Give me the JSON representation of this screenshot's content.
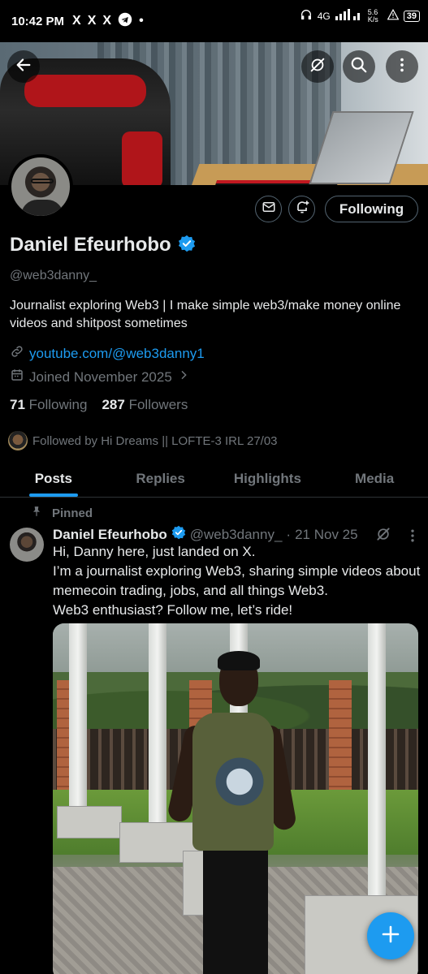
{
  "status_bar": {
    "time": "10:42 PM",
    "app_icons": [
      "X",
      "X",
      "X"
    ],
    "network": "4G",
    "speed": "5.6 K/s",
    "battery": "39"
  },
  "profile": {
    "display_name": "Daniel Efeurhobo",
    "handle": "@web3danny_",
    "bio": "Journalist exploring Web3 | I make simple web3/make money online videos and shitpost sometimes",
    "link": "youtube.com/@web3danny1",
    "joined": "Joined November 2025",
    "following_count": "71",
    "following_label": "Following",
    "followers_count": "287",
    "followers_label": "Followers",
    "followed_by": "Followed by Hi Dreams || LOFTE-3 IRL 27/03",
    "follow_button_label": "Following"
  },
  "colors": {
    "accent": "#1d9bf0",
    "muted": "#71767b",
    "text": "#e7e9ea",
    "background": "#000000"
  },
  "tabs": [
    {
      "label": "Posts",
      "active": true
    },
    {
      "label": "Replies",
      "active": false
    },
    {
      "label": "Highlights",
      "active": false
    },
    {
      "label": "Media",
      "active": false
    }
  ],
  "pinned_post": {
    "pinned_label": "Pinned",
    "author": "Daniel Efeurhobo",
    "handle": "@web3danny_",
    "separator": "·",
    "date": "21 Nov 25",
    "lines": [
      "Hi, Danny here, just landed on X.",
      "I’m a journalist exploring Web3, sharing simple videos about memecoin trading, jobs, and all things Web3.",
      "Web3 enthusiast? Follow me, let’s ride!"
    ]
  },
  "fab_icon": "plus-icon"
}
